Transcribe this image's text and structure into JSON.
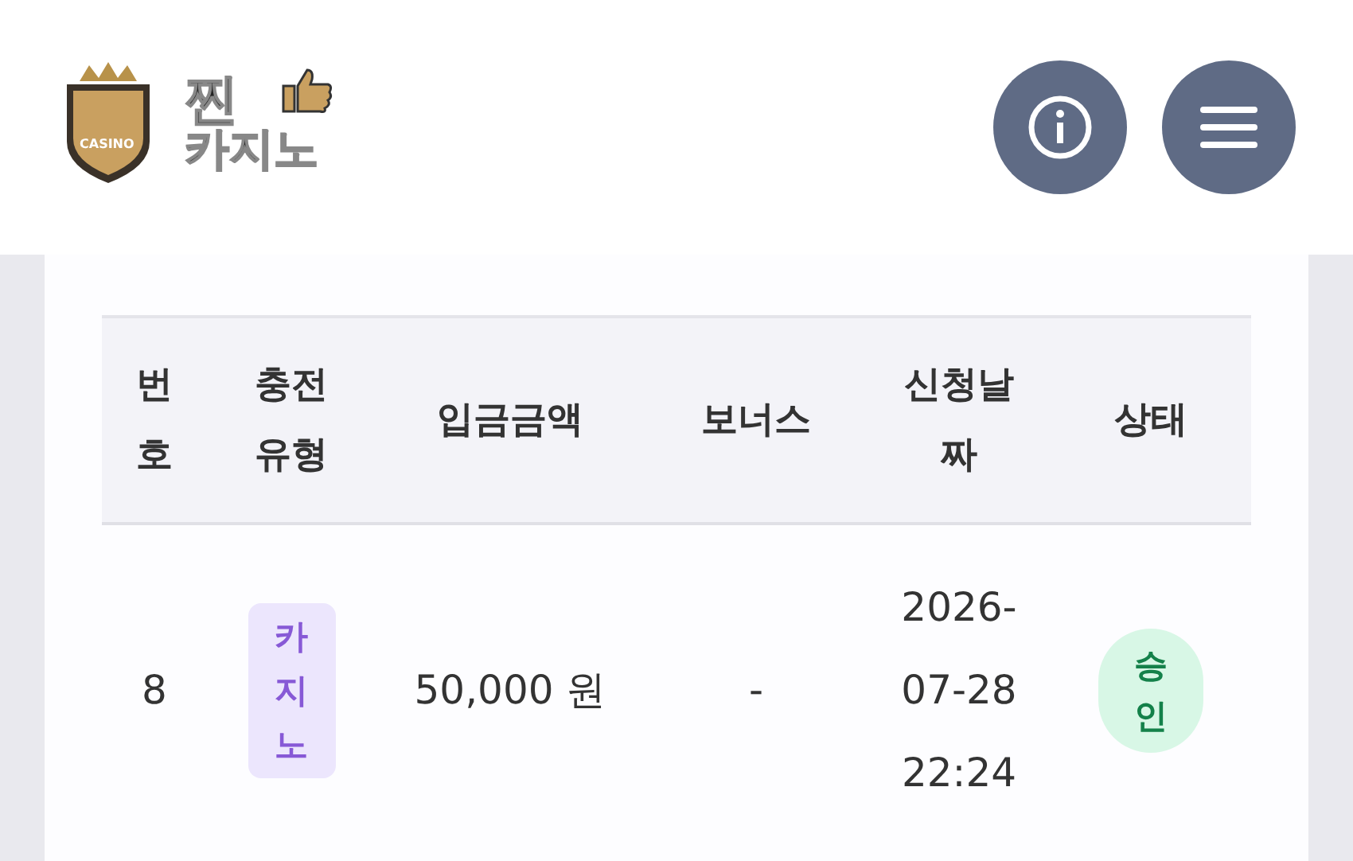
{
  "header": {
    "logo": {
      "line_1": "찐",
      "line_2": "카지노",
      "badge": "CASINO"
    },
    "buttons": [
      {
        "kind": "info"
      },
      {
        "kind": "menu"
      }
    ]
  },
  "table": {
    "columns": [
      "번호",
      "충전유형",
      "입금금액",
      "보너스",
      "신청날짜",
      "상태"
    ],
    "rows": [
      {
        "number": "8",
        "type": "카지노",
        "amount": "50,000 원",
        "bonus": "-",
        "date": "2026-07-28 22:24",
        "status": "승인"
      }
    ]
  }
}
